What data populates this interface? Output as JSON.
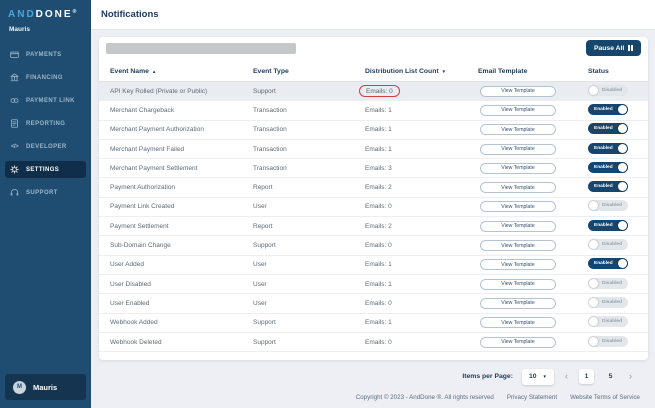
{
  "sidebar": {
    "logo": {
      "part1": "AND",
      "part2": "DONE",
      "reg": "®"
    },
    "org": "Mauris",
    "items": [
      {
        "label": "PAYMENTS",
        "icon": "payments-icon",
        "active": false
      },
      {
        "label": "FINANCING",
        "icon": "financing-icon",
        "active": false
      },
      {
        "label": "PAYMENT LINK",
        "icon": "payment-link-icon",
        "active": false
      },
      {
        "label": "REPORTING",
        "icon": "reporting-icon",
        "active": false
      },
      {
        "label": "DEVELOPER",
        "icon": "developer-icon",
        "active": false
      },
      {
        "label": "SETTINGS",
        "icon": "settings-icon",
        "active": true
      },
      {
        "label": "SUPPORT",
        "icon": "support-icon",
        "active": false
      }
    ],
    "user": {
      "initial": "M",
      "name": "Mauris"
    }
  },
  "header": {
    "title": "Notifications"
  },
  "toolbar": {
    "pause_all_label": "Pause All"
  },
  "icons": {
    "sort_asc": "▲",
    "sort_desc": "▼",
    "caret_down": "▼",
    "chevron_left": "‹",
    "chevron_right": "›"
  },
  "table": {
    "columns": [
      {
        "label": "Event Name",
        "sort_icon": "▲"
      },
      {
        "label": "Event Type"
      },
      {
        "label": "Distribution List Count",
        "sort_icon": "▼"
      },
      {
        "label": "Email Template"
      },
      {
        "label": "Status"
      }
    ],
    "view_template_label": "View Template",
    "rows": [
      {
        "event_name": "API Key Rolled (Private or Public)",
        "event_type": "Support",
        "emails_label": "Emails: 0",
        "status": "Disabled",
        "highlighted": true,
        "annotated": true
      },
      {
        "event_name": "Merchant Chargeback",
        "event_type": "Transaction",
        "emails_label": "Emails: 1",
        "status": "Enabled"
      },
      {
        "event_name": "Merchant Payment Authorization",
        "event_type": "Transaction",
        "emails_label": "Emails: 1",
        "status": "Enabled"
      },
      {
        "event_name": "Merchant Payment Failed",
        "event_type": "Transaction",
        "emails_label": "Emails: 1",
        "status": "Enabled"
      },
      {
        "event_name": "Merchant Payment Settlement",
        "event_type": "Transaction",
        "emails_label": "Emails: 3",
        "status": "Enabled"
      },
      {
        "event_name": "Payment Authorization",
        "event_type": "Report",
        "emails_label": "Emails: 2",
        "status": "Enabled"
      },
      {
        "event_name": "Payment Link Created",
        "event_type": "User",
        "emails_label": "Emails: 0",
        "status": "Disabled"
      },
      {
        "event_name": "Payment Settlement",
        "event_type": "Report",
        "emails_label": "Emails: 2",
        "status": "Enabled"
      },
      {
        "event_name": "Sub-Domain Change",
        "event_type": "Support",
        "emails_label": "Emails: 0",
        "status": "Disabled"
      },
      {
        "event_name": "User Added",
        "event_type": "User",
        "emails_label": "Emails: 1",
        "status": "Enabled"
      },
      {
        "event_name": "User Disabled",
        "event_type": "User",
        "emails_label": "Emails: 1",
        "status": "Disabled"
      },
      {
        "event_name": "User Enabled",
        "event_type": "User",
        "emails_label": "Emails: 0",
        "status": "Disabled"
      },
      {
        "event_name": "Webhook Added",
        "event_type": "Support",
        "emails_label": "Emails: 1",
        "status": "Disabled"
      },
      {
        "event_name": "Webhook Deleted",
        "event_type": "Support",
        "emails_label": "Emails: 0",
        "status": "Disabled"
      }
    ]
  },
  "pagination": {
    "items_per_page_label": "Items per Page:",
    "items_per_page_value": "10",
    "page_current": "1",
    "page_last": "5"
  },
  "footer": {
    "copyright": "Copyright © 2023 - AndDone ®. All rights reserved",
    "links": [
      "Privacy Statement",
      "Website Terms of Service"
    ]
  },
  "colors": {
    "sidebar_bg": "#1e4d71",
    "sidebar_active_bg": "#102e49",
    "logo_accent": "#4ba4d8",
    "accent_navy": "#16466e",
    "annotation_red": "#cf3f3f",
    "page_bg": "#edeff4",
    "disabled_pill_bg": "#e3e7ec",
    "row_highlight_bg": "#e9ecf0"
  }
}
